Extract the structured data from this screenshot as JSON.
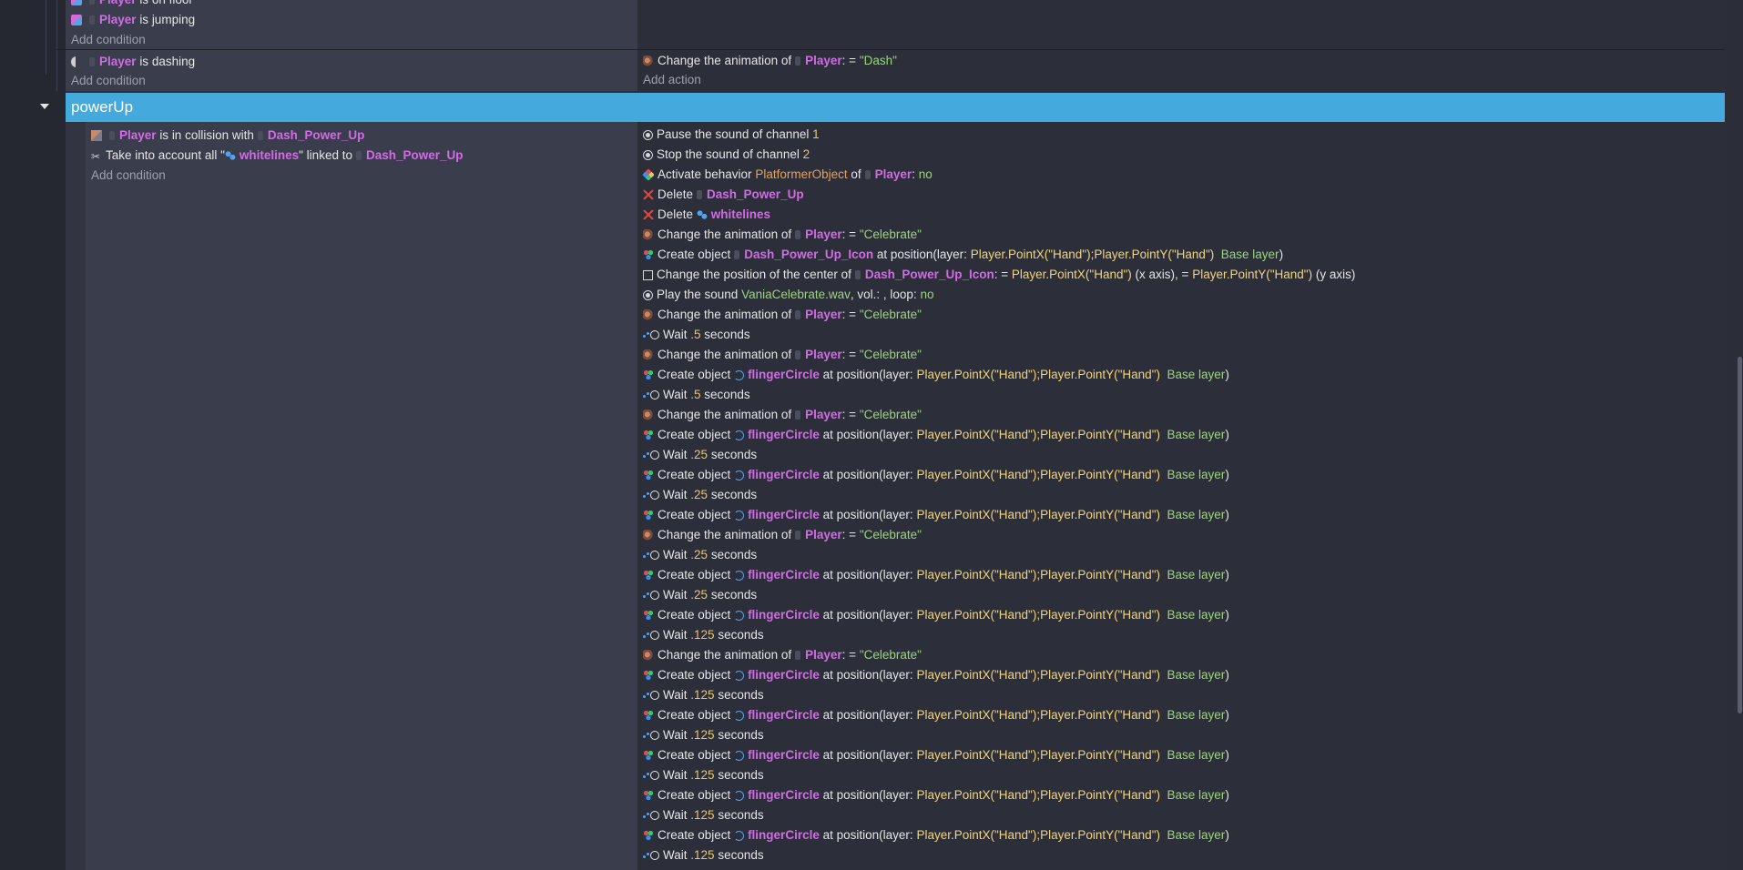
{
  "top_event": {
    "conditions": [
      {
        "object": "Player",
        "text": "is on floor"
      },
      {
        "object": "Player",
        "text": "is jumping"
      }
    ],
    "add_condition": "Add condition"
  },
  "dash_event": {
    "condition": {
      "object": "Player",
      "text": "is dashing"
    },
    "add_condition": "Add condition",
    "action": {
      "prefix": "Change the animation of",
      "object": "Player",
      "suffix": ": =",
      "value": "\"Dash\""
    },
    "add_action": "Add action"
  },
  "group": {
    "title": "powerUp"
  },
  "powerup_event": {
    "conditions": [
      {
        "object": "Player",
        "text": "is in collision with",
        "target": "Dash_Power_Up"
      },
      {
        "prefix": "Take into account all \"",
        "group": "whitelines",
        "mid": "\" linked to",
        "target": "Dash_Power_Up"
      }
    ],
    "add_condition": "Add condition",
    "actions": [
      {
        "icon": "sound-icon",
        "t1": "Pause the sound of channel",
        "num": "1"
      },
      {
        "icon": "sound-icon",
        "t1": "Stop the sound of channel",
        "num": "2"
      },
      {
        "icon": "behavior-icon",
        "t1": "Activate behavior",
        "bhv": "PlatformerObject",
        "t2": "of",
        "obj": "Player",
        "t3": ":",
        "val": "no"
      },
      {
        "icon": "delete-icon",
        "t1": "Delete",
        "obj": "Dash_Power_Up"
      },
      {
        "icon": "delete-icon",
        "t1": "Delete",
        "obj": "whitelines"
      },
      {
        "icon": "animation-icon",
        "t1": "Change the animation of",
        "obj": "Player",
        "t3": ": =",
        "val": "\"Celebrate\""
      },
      {
        "icon": "create-icon",
        "t1": "Create object",
        "obj": "Dash_Power_Up_Icon",
        "t2": "at position",
        "expr": "Player.PointX(\"Hand\");Player.PointY(\"Hand\")",
        "t3": "(layer:",
        "val": "Base layer",
        "t4": ")"
      },
      {
        "icon": "position-icon",
        "t1": "Change the position of the center of",
        "obj": "Dash_Power_Up_Icon",
        "t3": ": =",
        "expr": "Player.PointX(\"Hand\")",
        "t4": "(x axis), =",
        "expr2": "Player.PointY(\"Hand\")",
        "t5": "(y axis)"
      },
      {
        "icon": "sound-icon",
        "t1": "Play the sound",
        "val": "VaniaCelebrate.wav",
        "t2": ", vol.: , loop:",
        "val2": "no"
      },
      {
        "icon": "animation-icon",
        "t1": "Change the animation of",
        "obj": "Player",
        "t3": ": =",
        "val": "\"Celebrate\""
      },
      {
        "icon": "wait-icon",
        "t1": "Wait",
        "num": ".5",
        "t2": "seconds"
      },
      {
        "icon": "animation-icon",
        "t1": "Change the animation of",
        "obj": "Player",
        "t3": ": =",
        "val": "\"Celebrate\""
      },
      {
        "icon": "create-icon",
        "t1": "Create object",
        "obj": "flingerCircle",
        "t2": "at position",
        "expr": "Player.PointX(\"Hand\");Player.PointY(\"Hand\")",
        "t3": "(layer:",
        "val": "Base layer",
        "t4": ")"
      },
      {
        "icon": "wait-icon",
        "t1": "Wait",
        "num": ".5",
        "t2": "seconds"
      },
      {
        "icon": "animation-icon",
        "t1": "Change the animation of",
        "obj": "Player",
        "t3": ": =",
        "val": "\"Celebrate\""
      },
      {
        "icon": "create-icon",
        "t1": "Create object",
        "obj": "flingerCircle",
        "t2": "at position",
        "expr": "Player.PointX(\"Hand\");Player.PointY(\"Hand\")",
        "t3": "(layer:",
        "val": "Base layer",
        "t4": ")"
      },
      {
        "icon": "wait-icon",
        "t1": "Wait",
        "num": ".25",
        "t2": "seconds"
      },
      {
        "icon": "create-icon",
        "t1": "Create object",
        "obj": "flingerCircle",
        "t2": "at position",
        "expr": "Player.PointX(\"Hand\");Player.PointY(\"Hand\")",
        "t3": "(layer:",
        "val": "Base layer",
        "t4": ")"
      },
      {
        "icon": "wait-icon",
        "t1": "Wait",
        "num": ".25",
        "t2": "seconds"
      },
      {
        "icon": "create-icon",
        "t1": "Create object",
        "obj": "flingerCircle",
        "t2": "at position",
        "expr": "Player.PointX(\"Hand\");Player.PointY(\"Hand\")",
        "t3": "(layer:",
        "val": "Base layer",
        "t4": ")"
      },
      {
        "icon": "animation-icon",
        "t1": "Change the animation of",
        "obj": "Player",
        "t3": ": =",
        "val": "\"Celebrate\""
      },
      {
        "icon": "wait-icon",
        "t1": "Wait",
        "num": ".25",
        "t2": "seconds"
      },
      {
        "icon": "create-icon",
        "t1": "Create object",
        "obj": "flingerCircle",
        "t2": "at position",
        "expr": "Player.PointX(\"Hand\");Player.PointY(\"Hand\")",
        "t3": "(layer:",
        "val": "Base layer",
        "t4": ")"
      },
      {
        "icon": "wait-icon",
        "t1": "Wait",
        "num": ".25",
        "t2": "seconds"
      },
      {
        "icon": "create-icon",
        "t1": "Create object",
        "obj": "flingerCircle",
        "t2": "at position",
        "expr": "Player.PointX(\"Hand\");Player.PointY(\"Hand\")",
        "t3": "(layer:",
        "val": "Base layer",
        "t4": ")"
      },
      {
        "icon": "wait-icon",
        "t1": "Wait",
        "num": ".125",
        "t2": "seconds"
      },
      {
        "icon": "animation-icon",
        "t1": "Change the animation of",
        "obj": "Player",
        "t3": ": =",
        "val": "\"Celebrate\""
      },
      {
        "icon": "create-icon",
        "t1": "Create object",
        "obj": "flingerCircle",
        "t2": "at position",
        "expr": "Player.PointX(\"Hand\");Player.PointY(\"Hand\")",
        "t3": "(layer:",
        "val": "Base layer",
        "t4": ")"
      },
      {
        "icon": "wait-icon",
        "t1": "Wait",
        "num": ".125",
        "t2": "seconds"
      },
      {
        "icon": "create-icon",
        "t1": "Create object",
        "obj": "flingerCircle",
        "t2": "at position",
        "expr": "Player.PointX(\"Hand\");Player.PointY(\"Hand\")",
        "t3": "(layer:",
        "val": "Base layer",
        "t4": ")"
      },
      {
        "icon": "wait-icon",
        "t1": "Wait",
        "num": ".125",
        "t2": "seconds"
      },
      {
        "icon": "create-icon",
        "t1": "Create object",
        "obj": "flingerCircle",
        "t2": "at position",
        "expr": "Player.PointX(\"Hand\");Player.PointY(\"Hand\")",
        "t3": "(layer:",
        "val": "Base layer",
        "t4": ")"
      },
      {
        "icon": "wait-icon",
        "t1": "Wait",
        "num": ".125",
        "t2": "seconds"
      },
      {
        "icon": "create-icon",
        "t1": "Create object",
        "obj": "flingerCircle",
        "t2": "at position",
        "expr": "Player.PointX(\"Hand\");Player.PointY(\"Hand\")",
        "t3": "(layer:",
        "val": "Base layer",
        "t4": ")"
      },
      {
        "icon": "wait-icon",
        "t1": "Wait",
        "num": ".125",
        "t2": "seconds"
      },
      {
        "icon": "create-icon",
        "t1": "Create object",
        "obj": "flingerCircle",
        "t2": "at position",
        "expr": "Player.PointX(\"Hand\");Player.PointY(\"Hand\")",
        "t3": "(layer:",
        "val": "Base layer",
        "t4": ")"
      },
      {
        "icon": "wait-icon",
        "t1": "Wait",
        "num": ".125",
        "t2": "seconds"
      }
    ]
  }
}
